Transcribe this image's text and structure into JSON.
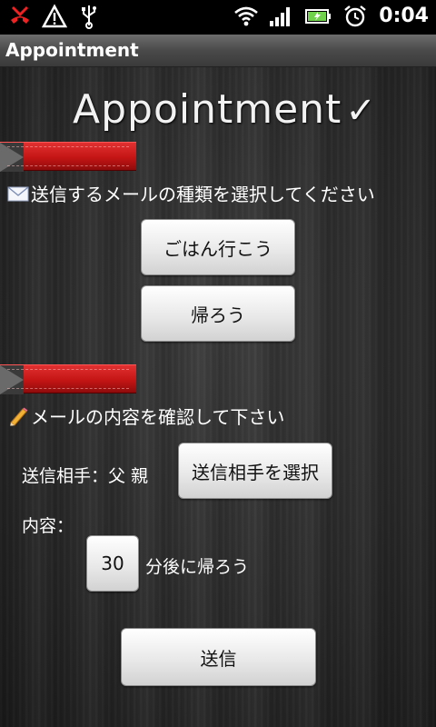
{
  "status_bar": {
    "time": "0:04",
    "left_icons": [
      "missed-call-icon",
      "warning-icon",
      "usb-icon"
    ],
    "right_icons": [
      "wifi-icon",
      "signal-icon",
      "battery-icon",
      "alarm-icon"
    ]
  },
  "title_bar": {
    "title": "Appointment"
  },
  "logo": {
    "text": "Appointment",
    "check": "✓"
  },
  "section1": {
    "label": "送信するメールの種類を選択してください",
    "buttons": {
      "dinner": "ごはん行こう",
      "go_home": "帰ろう"
    }
  },
  "section2": {
    "label": "メールの内容を確認して下さい",
    "recipient_label": "送信相手：父 親",
    "select_recipient_button": "送信相手を選択",
    "content_label": "内容：",
    "minutes_value": "30",
    "message_suffix": "分後に帰ろう",
    "send_button": "送信"
  },
  "colors": {
    "ribbon": "#d21f1f",
    "background": "#2a2a2a",
    "button": "#eeeeee"
  }
}
